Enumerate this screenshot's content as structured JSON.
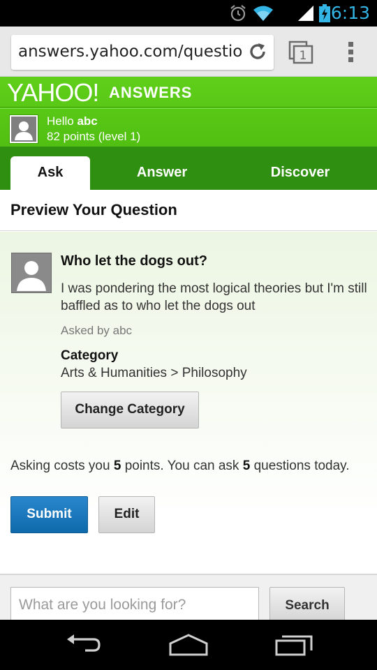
{
  "status_bar": {
    "time": "6:13",
    "icons": [
      "alarm-icon",
      "wifi-icon",
      "signal-icon",
      "battery-charging-icon"
    ],
    "time_color": "#33b5e5"
  },
  "browser": {
    "url": "answers.yahoo.com/question/ask",
    "icons": [
      "reload-icon",
      "tabs-icon",
      "overflow-menu-icon"
    ],
    "tab_count": "1"
  },
  "header": {
    "logo_yahoo": "YAHOO!",
    "logo_answers": "ANSWERS",
    "user": {
      "hello_prefix": "Hello ",
      "username": "abc",
      "points_text": "82 points (level 1)"
    },
    "tabs": [
      {
        "label": "Ask",
        "active": true
      },
      {
        "label": "Answer",
        "active": false
      },
      {
        "label": "Discover",
        "active": false
      }
    ],
    "brand_color": "#4fbf12"
  },
  "preview": {
    "title": "Preview Your Question"
  },
  "question": {
    "title": "Who let the dogs out?",
    "body": "I was pondering the most logical theories but I'm still baffled as to who let the dogs out",
    "asked_by": "Asked by abc",
    "category_label": "Category",
    "category_value": "Arts & Humanities > Philosophy",
    "change_category_label": "Change Category"
  },
  "cost": {
    "prefix": "Asking costs you ",
    "cost_points": "5",
    "middle": " points. You can ask ",
    "questions_left": "5",
    "suffix": " questions today."
  },
  "actions": {
    "submit_label": "Submit",
    "edit_label": "Edit",
    "submit_color": "#1a78bd"
  },
  "search": {
    "placeholder": "What are you looking for?",
    "button_label": "Search"
  },
  "nav_bar": {
    "icons": [
      "back-icon",
      "home-icon",
      "recent-apps-icon"
    ]
  }
}
